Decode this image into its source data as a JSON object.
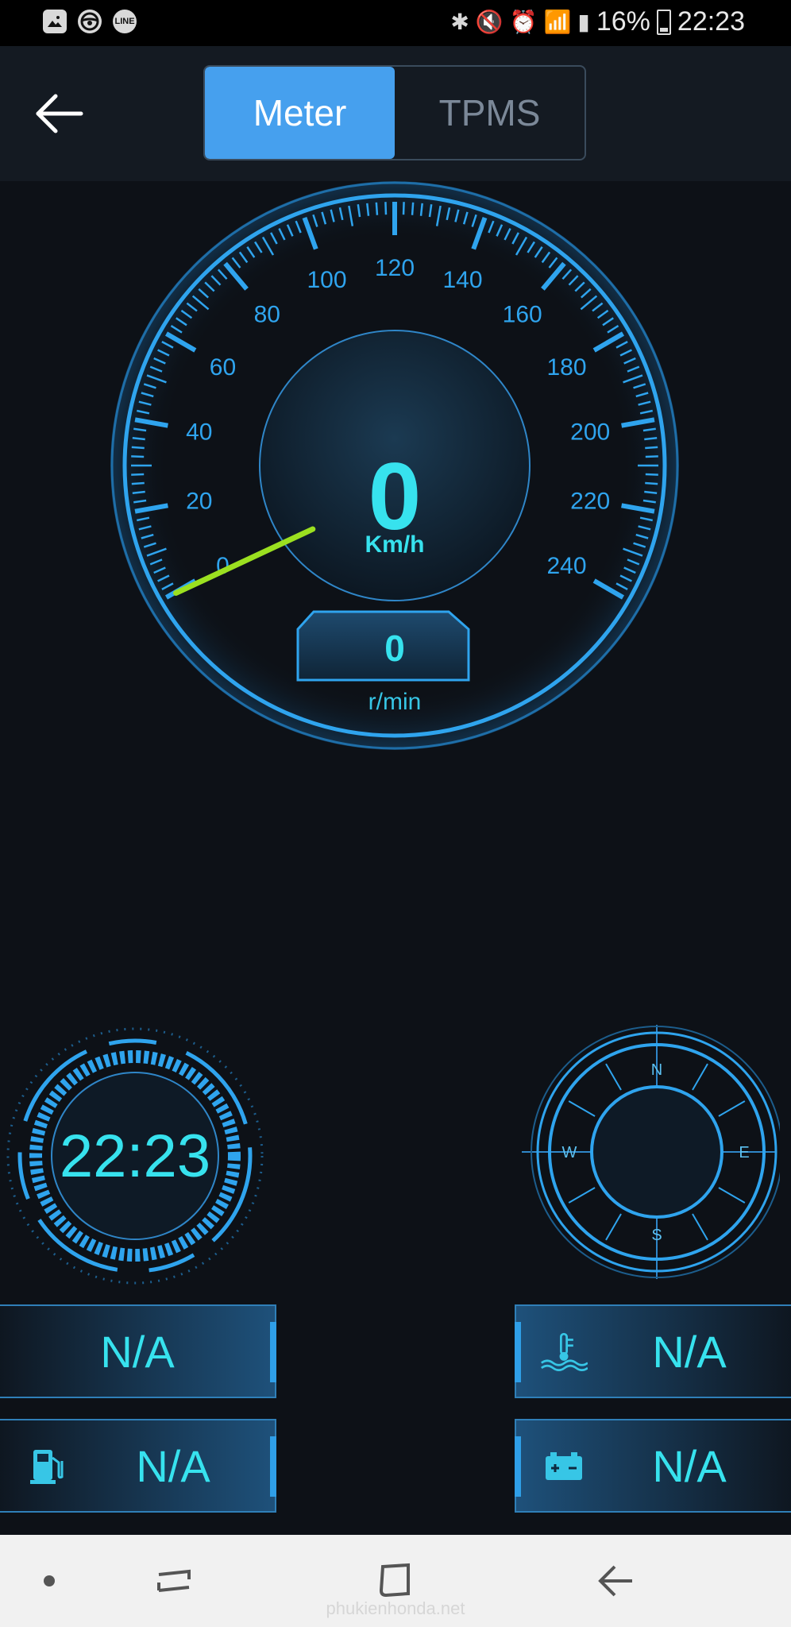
{
  "status_bar": {
    "battery": "16%",
    "time": "22:23",
    "line_app_label": "LINE",
    "left_icons": [
      "gallery-icon",
      "steering-wheel-icon",
      "line-app-icon"
    ],
    "right_icons": [
      "bluetooth-icon",
      "mute-icon",
      "alarm-icon",
      "wifi-calling-icon",
      "signal-icon",
      "battery-icon"
    ]
  },
  "header": {
    "tabs": [
      {
        "label": "Meter",
        "active": true
      },
      {
        "label": "TPMS",
        "active": false
      }
    ]
  },
  "speedometer": {
    "speed": "0",
    "speed_unit": "Km/h",
    "rpm": "0",
    "rpm_unit": "r/min",
    "scale_labels": [
      "0",
      "20",
      "40",
      "60",
      "80",
      "100",
      "120",
      "140",
      "160",
      "180",
      "200",
      "220",
      "240"
    ],
    "needle_value": 0,
    "accent_color": "#2fa4ee",
    "needle_color": "#9be020"
  },
  "clock": {
    "time": "22:23"
  },
  "compass": {
    "labels": [
      "N",
      "E",
      "S",
      "W"
    ]
  },
  "panels": {
    "left_top": {
      "value": "N/A"
    },
    "left_bottom": {
      "value": "N/A",
      "icon": "fuel-pump-icon"
    },
    "right_top": {
      "value": "N/A",
      "icon": "coolant-temperature-icon"
    },
    "right_bottom": {
      "value": "N/A",
      "icon": "battery-icon"
    }
  },
  "navbar": {
    "buttons": [
      "home-dot",
      "recent-apps",
      "home",
      "back"
    ]
  },
  "watermark": "phukienhonda.net"
}
